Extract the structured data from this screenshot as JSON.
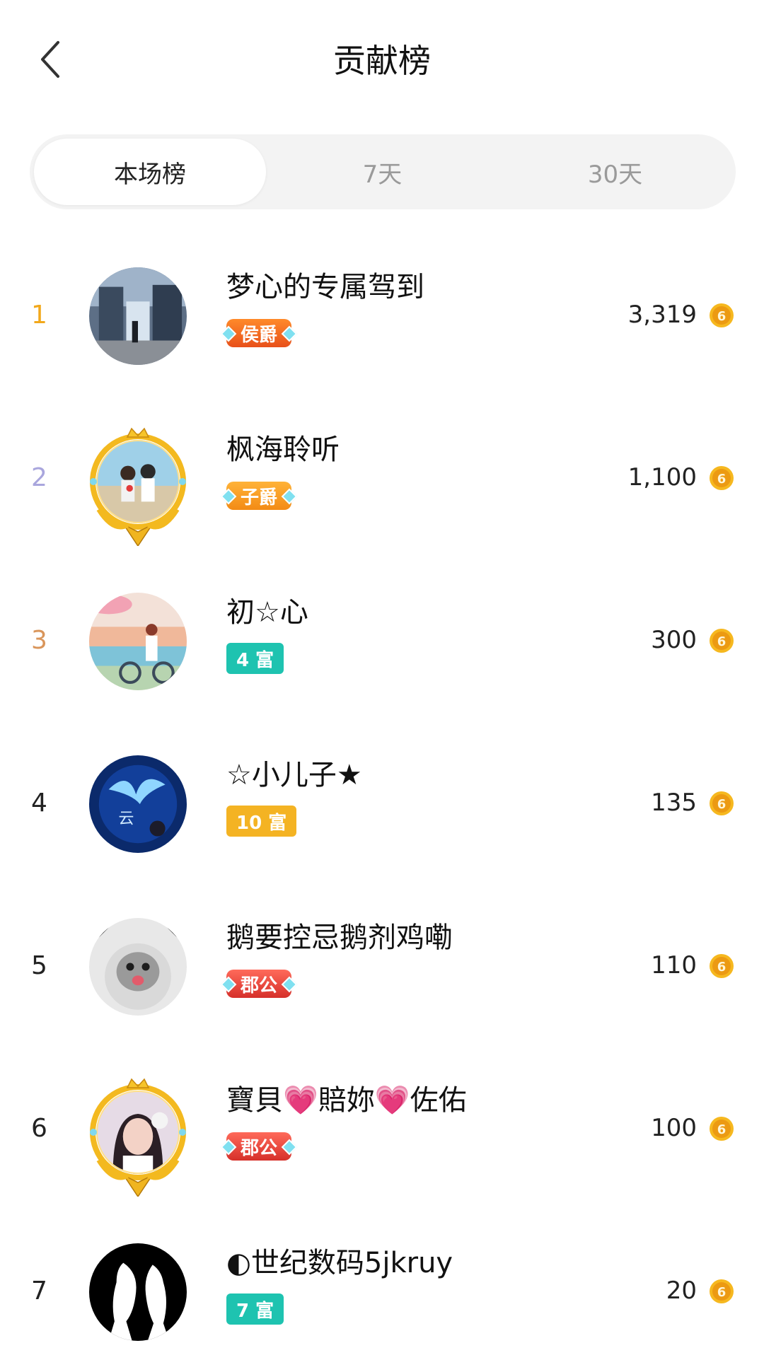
{
  "header": {
    "title": "贡献榜"
  },
  "tabs": [
    {
      "label": "本场榜",
      "active": true
    },
    {
      "label": "7天",
      "active": false
    },
    {
      "label": "30天",
      "active": false
    }
  ],
  "colors": {
    "rank1": "#f2a81b",
    "rank2": "#a9a6dd",
    "rank3": "#d9955a",
    "badge_marquis": "#f26a1b",
    "badge_viscount": "#f6a21e",
    "badge_duke": "#e8463e",
    "rich_teal": "#1ec3b0",
    "rich_gold": "#f4b323",
    "coin": "#f2a81b"
  },
  "rows": [
    {
      "rank": "1",
      "name": "梦心的专属驾到",
      "badge": "侯爵",
      "badge_type": "title",
      "score": "3,319",
      "avatar_icon": "mall-photo-avatar-icon",
      "frame": false
    },
    {
      "rank": "2",
      "name": "枫海聆听",
      "badge": "子爵",
      "badge_type": "title",
      "score": "1,100",
      "avatar_icon": "couple-beach-avatar-icon",
      "frame": true
    },
    {
      "rank": "3",
      "name": "初☆心",
      "badge": "4 富",
      "badge_type": "rich",
      "score": "300",
      "avatar_icon": "girl-bicycle-avatar-icon",
      "frame": false
    },
    {
      "rank": "4",
      "name": "☆小儿子★",
      "badge": "10 富",
      "badge_type": "rich",
      "score": "135",
      "avatar_icon": "blue-bird-avatar-icon",
      "frame": false
    },
    {
      "rank": "5",
      "name": "鹅要控忌鹅剂鸡嘞",
      "badge": "郡公",
      "badge_type": "title",
      "score": "110",
      "avatar_icon": "cat-hoodie-avatar-icon",
      "frame": false
    },
    {
      "rank": "6",
      "name": "寶貝💗賠妳💗佐佑",
      "badge": "郡公",
      "badge_type": "title",
      "score": "100",
      "avatar_icon": "woman-portrait-avatar-icon",
      "frame": true
    },
    {
      "rank": "7",
      "name": "◐世纪数码5jkruy",
      "badge": "7 富",
      "badge_type": "rich",
      "score": "20",
      "avatar_icon": "silhouette-couple-avatar-icon",
      "frame": false
    }
  ]
}
